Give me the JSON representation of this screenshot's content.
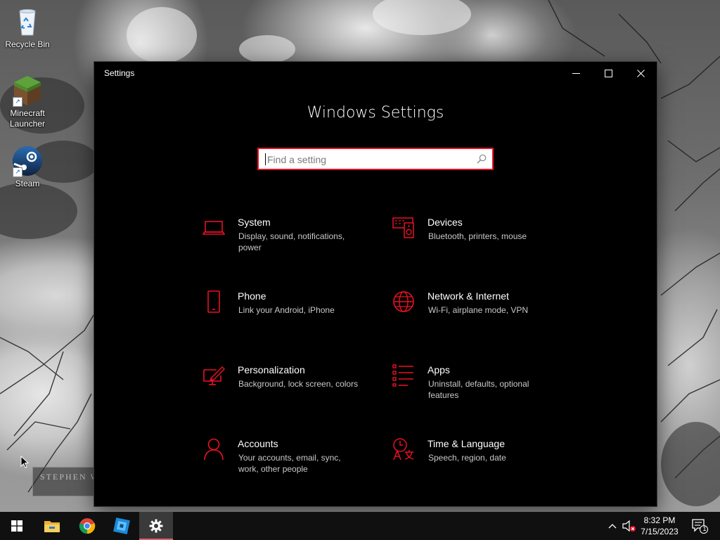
{
  "desktop": {
    "icons": [
      {
        "label": "Recycle Bin",
        "icon": "recycle-bin-icon"
      },
      {
        "label": "Minecraft Launcher",
        "icon": "minecraft-icon"
      },
      {
        "label": "Steam",
        "icon": "steam-icon"
      }
    ],
    "watermark": "STEPHEN W"
  },
  "window": {
    "title": "Settings",
    "heading": "Windows Settings",
    "search_placeholder": "Find a setting",
    "accent": "#e81123",
    "categories": [
      {
        "name": "System",
        "description": "Display, sound, notifications, power",
        "icon": "laptop-icon"
      },
      {
        "name": "Devices",
        "description": "Bluetooth, printers, mouse",
        "icon": "keyboard-speaker-icon"
      },
      {
        "name": "Phone",
        "description": "Link your Android, iPhone",
        "icon": "phone-icon"
      },
      {
        "name": "Network & Internet",
        "description": "Wi-Fi, airplane mode, VPN",
        "icon": "globe-icon"
      },
      {
        "name": "Personalization",
        "description": "Background, lock screen, colors",
        "icon": "paint-icon"
      },
      {
        "name": "Apps",
        "description": "Uninstall, defaults, optional features",
        "icon": "apps-list-icon"
      },
      {
        "name": "Accounts",
        "description": "Your accounts, email, sync, work, other people",
        "icon": "person-icon"
      },
      {
        "name": "Time & Language",
        "description": "Speech, region, date",
        "icon": "time-language-icon"
      }
    ]
  },
  "taskbar": {
    "pinned": [
      "windows-start-icon",
      "file-explorer-icon",
      "chrome-icon",
      "roblox-studio-icon",
      "settings-gear-icon"
    ],
    "time": "8:32 PM",
    "date": "7/15/2023",
    "notification_count": "1"
  }
}
